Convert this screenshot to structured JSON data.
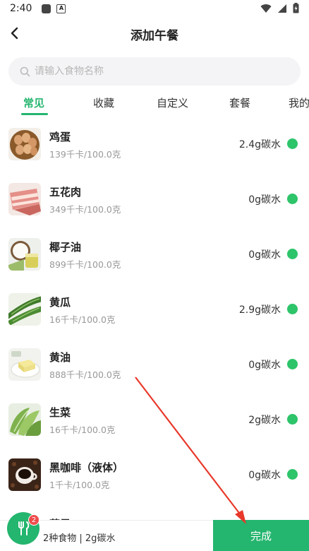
{
  "status_bar": {
    "time": "2:40",
    "notification_icons": [
      "square-icon",
      "a-icon"
    ],
    "right_icons": [
      "wifi-icon",
      "signal-icon",
      "battery-icon"
    ]
  },
  "header": {
    "back_icon": "chevron-left-icon",
    "title": "添加午餐"
  },
  "search": {
    "placeholder": "请输入食物名称",
    "value": ""
  },
  "tabs": [
    {
      "label": "常见",
      "active": true
    },
    {
      "label": "收藏",
      "active": false
    },
    {
      "label": "自定义",
      "active": false
    },
    {
      "label": "套餐",
      "active": false
    },
    {
      "label": "我的",
      "active": false
    }
  ],
  "foods": [
    {
      "name": "鸡蛋",
      "calories": "139千卡/100.0克",
      "carbs": "2.4g碳水",
      "image": "eggs"
    },
    {
      "name": "五花肉",
      "calories": "349千卡/100.0克",
      "carbs": "0g碳水",
      "image": "pork-belly"
    },
    {
      "name": "椰子油",
      "calories": "899千卡/100.0克",
      "carbs": "0g碳水",
      "image": "coconut-oil"
    },
    {
      "name": "黄瓜",
      "calories": "16千卡/100.0克",
      "carbs": "2.9g碳水",
      "image": "cucumber"
    },
    {
      "name": "黄油",
      "calories": "888千卡/100.0克",
      "carbs": "0g碳水",
      "image": "butter"
    },
    {
      "name": "生菜",
      "calories": "16千卡/100.0克",
      "carbs": "2g碳水",
      "image": "lettuce"
    },
    {
      "name": "黑咖啡（液体）",
      "calories": "1千卡/100.0克",
      "carbs": "0g碳水",
      "image": "black-coffee"
    },
    {
      "name": "草果",
      "calories": "",
      "carbs": "",
      "image": "partial"
    }
  ],
  "colors": {
    "accent": "#24b56e",
    "status_dot": "#2ec46a",
    "badge": "#ef4b4b"
  },
  "bottom_bar": {
    "cart_count": "2",
    "summary": "2种食物 | 2g碳水",
    "done_label": "完成"
  }
}
